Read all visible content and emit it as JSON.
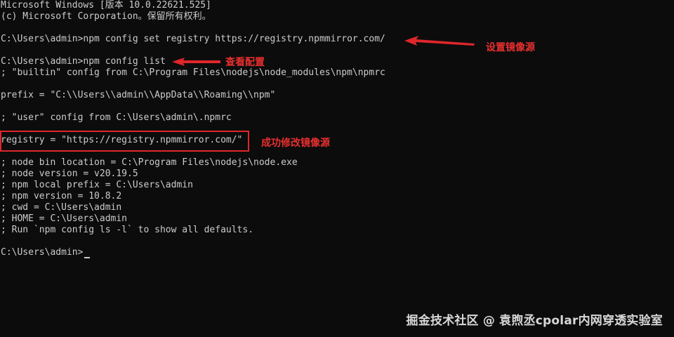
{
  "terminal": {
    "lines": [
      "Microsoft Windows [版本 10.0.22621.525]",
      "(c) Microsoft Corporation。保留所有权利。",
      "",
      "C:\\Users\\admin>npm config set registry https://registry.npmmirror.com/",
      "",
      "C:\\Users\\admin>npm config list",
      "; \"builtin\" config from C:\\Program Files\\nodejs\\node_modules\\npm\\npmrc",
      "",
      "prefix = \"C:\\\\Users\\\\admin\\\\AppData\\\\Roaming\\\\npm\"",
      "",
      "; \"user\" config from C:\\Users\\admin\\.npmrc",
      "",
      "registry = \"https://registry.npmmirror.com/\"",
      "",
      "; node bin location = C:\\Program Files\\nodejs\\node.exe",
      "; node version = v20.19.5",
      "; npm local prefix = C:\\Users\\admin",
      "; npm version = 10.8.2",
      "; cwd = C:\\Users\\admin",
      "; HOME = C:\\Users\\admin",
      "; Run `npm config ls -l` to show all defaults.",
      "",
      "C:\\Users\\admin>"
    ]
  },
  "annotations": {
    "set_mirror": "设置镜像源",
    "view_config": "查看配置",
    "modified_success": "成功修改镜像源",
    "color": "#e8302f"
  },
  "watermark": "掘金技术社区 @ 袁煦丞cpolar内网穿透实验室"
}
